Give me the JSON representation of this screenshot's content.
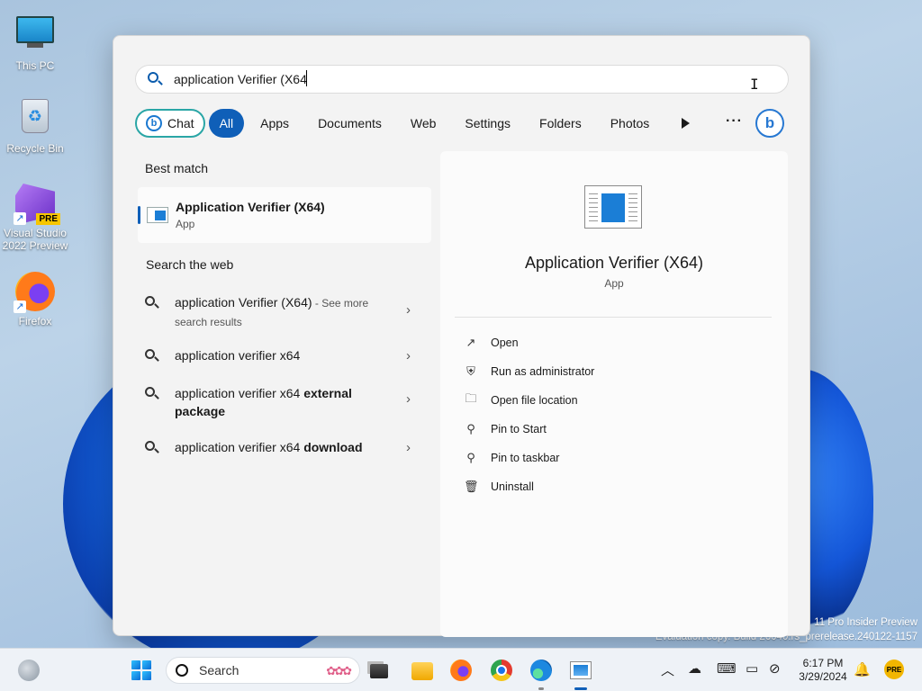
{
  "desktop": {
    "icons": [
      {
        "label": "This PC",
        "icon": "this-pc-icon"
      },
      {
        "label": "Recycle Bin",
        "icon": "recycle-bin-icon"
      },
      {
        "label": "Visual Studio 2022 Preview",
        "badge": "PRE",
        "icon": "visual-studio-icon"
      },
      {
        "label": "Firefox",
        "icon": "firefox-icon"
      }
    ],
    "watermark_line1": "11 Pro Insider Preview",
    "watermark_line2": "Evaluation copy. Build 26040.rs_prerelease.240122-1157"
  },
  "search": {
    "query": "application Verifier (X64",
    "filters": [
      {
        "label": "Chat",
        "active": false
      },
      {
        "label": "All",
        "active": true
      },
      {
        "label": "Apps",
        "active": false
      },
      {
        "label": "Documents",
        "active": false
      },
      {
        "label": "Web",
        "active": false
      },
      {
        "label": "Settings",
        "active": false
      },
      {
        "label": "Folders",
        "active": false
      },
      {
        "label": "Photos",
        "active": false
      }
    ],
    "more_label": "···",
    "bing_label": "b"
  },
  "results": {
    "best_match_title": "Best match",
    "best_match": {
      "name": "Application Verifier (X64)",
      "type": "App"
    },
    "web_title": "Search the web",
    "web_items": [
      {
        "text": "application Verifier (X64)",
        "suffix": " - See more search results"
      },
      {
        "text": "application verifier x64",
        "bold": ""
      },
      {
        "text": "application verifier x64 ",
        "bold": "external package"
      },
      {
        "text": "application verifier x64 ",
        "bold": "download"
      }
    ]
  },
  "detail": {
    "name": "Application Verifier (X64)",
    "type": "App",
    "actions": [
      {
        "label": "Open",
        "icon": "open-external-icon",
        "glyph": "↗"
      },
      {
        "label": "Run as administrator",
        "icon": "shield-icon",
        "glyph": "⛨"
      },
      {
        "label": "Open file location",
        "icon": "folder-icon",
        "glyph": "🗀"
      },
      {
        "label": "Pin to Start",
        "icon": "pin-icon",
        "glyph": "⚲"
      },
      {
        "label": "Pin to taskbar",
        "icon": "pin-icon",
        "glyph": "⚲"
      },
      {
        "label": "Uninstall",
        "icon": "trash-icon",
        "glyph": "🗑"
      }
    ]
  },
  "taskbar": {
    "search_label": "Search",
    "time": "6:17 PM",
    "date": "3/29/2024",
    "badge": "PRE",
    "accent_color": "#0f5fb8"
  }
}
